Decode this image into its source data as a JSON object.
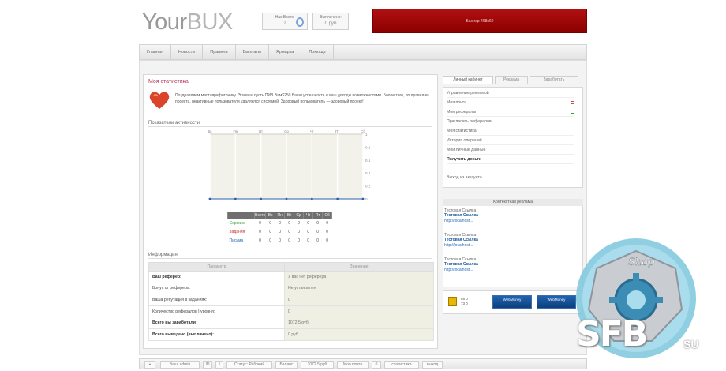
{
  "header": {
    "logo_part1": "Your",
    "logo_part2": "BUX",
    "box1_label": "Нас Всего:",
    "box1_value": "2",
    "box2_label": "Выплачено:",
    "box2_value": "0 руб",
    "banner_text": "Баннер 468x60"
  },
  "nav": {
    "items": [
      "Главная",
      "Новости",
      "Правила",
      "Выплаты",
      "Ярмарка",
      "Помощь"
    ]
  },
  "stats": {
    "title": "Моя статистика",
    "welcome": "Поздравляем маставрифотонику. Эти ваш пусть ПИВ Вам$250 Ваши успешность и ваш доходы возможностями. Более того, по правилам проекта, неактивные пользователи удаляются системой. Здоровый пользователь — здоровый проект!",
    "welcome_strong": "ПИВ Вам$250",
    "activity_title": "Показатели активности"
  },
  "chart_data": {
    "type": "line",
    "categories": [
      "Вс",
      "Пн",
      "Вт",
      "Ср",
      "Чт",
      "Пт",
      "Сб"
    ],
    "series": [
      {
        "values": [
          0,
          0,
          0,
          0,
          0,
          0,
          0
        ],
        "color": "#2f5fa8"
      }
    ],
    "y_ticks": [
      "1",
      "0.8",
      "0.6",
      "0.4",
      "0.2",
      "0"
    ],
    "ylim": [
      0,
      1
    ],
    "grid": true,
    "background": "#f2f2ea"
  },
  "stat_table": {
    "headers": [
      "",
      "Всего",
      "Вс",
      "Пн",
      "Вт",
      "Ср",
      "Чт",
      "Пт",
      "Сб"
    ],
    "rows": [
      {
        "label": "Серфинг",
        "color": "#3aa03a",
        "values": [
          "0",
          "0",
          "0",
          "0",
          "0",
          "0",
          "0",
          "0"
        ]
      },
      {
        "label": "Задания",
        "color": "#c03030",
        "values": [
          "0",
          "0",
          "0",
          "0",
          "0",
          "0",
          "0",
          "0"
        ]
      },
      {
        "label": "Письма",
        "color": "#2a6ab8",
        "values": [
          "0",
          "0",
          "0",
          "0",
          "0",
          "0",
          "0",
          "0"
        ]
      }
    ]
  },
  "info": {
    "title": "Информация",
    "col1": "Параметр",
    "col2": "Значение",
    "rows": [
      {
        "key": "Ваш реферер:",
        "value": "У вас нет реферера",
        "bold": true
      },
      {
        "key": "Бонус от реферера:",
        "value": "Не установлен",
        "bold": false
      },
      {
        "key": "Ваша репутация в заданиях:",
        "value": "0",
        "bold": false
      },
      {
        "key": "Количество рефералов I уровня:",
        "value": "0",
        "bold": false
      },
      {
        "key": "Всего вы заработали:",
        "value": "1072.5 руб",
        "bold": true
      },
      {
        "key": "Всего выведено (выплачено):",
        "value": "0 руб",
        "bold": true
      }
    ]
  },
  "right_tabs": [
    "Личный кабинет",
    "Реклама",
    "Заработать"
  ],
  "cabinet": {
    "items": [
      {
        "label": "Управление рекламой",
        "icon": ""
      },
      {
        "label": "Моя почта",
        "icon": "#d04a4a"
      },
      {
        "label": "Мои рефералы",
        "icon": "#3a9a3a"
      },
      {
        "label": "Пригласить рефералов",
        "icon": ""
      },
      {
        "label": "Моя статистика",
        "icon": ""
      },
      {
        "label": "История операций",
        "icon": ""
      },
      {
        "label": "Мои личные данные",
        "icon": ""
      },
      {
        "label": "Получить деньги",
        "icon": ""
      },
      {
        "label": "Выход из аккаунта",
        "icon": ""
      }
    ]
  },
  "ads": {
    "title": "Контекстная реклама",
    "items": [
      {
        "t1": "Тестовая Ссылка",
        "t2": "Тестовая Ссылка",
        "t3": "http://localhost..."
      },
      {
        "t1": "Тестовая Ссылка",
        "t2": "Тестовая Ссылка",
        "t3": "http://localhost..."
      },
      {
        "t1": "Тестовая Ссылка",
        "t2": "Тестовая Ссылка",
        "t3": "http://localhost..."
      }
    ]
  },
  "counter": {
    "line1": "88 0",
    "line2": "73 0",
    "wm1": "WebMoney",
    "wm2": "WebMoney"
  },
  "footer": {
    "items": [
      "Ваш: admin",
      "ID",
      "1",
      "Статус: Рабочий",
      "Баланс",
      "1072.5 руб",
      "Моя почта",
      "0",
      "статистика",
      "выход"
    ]
  },
  "watermark": {
    "shop": "Shop",
    "main": "SFB",
    "tld": "SU"
  }
}
